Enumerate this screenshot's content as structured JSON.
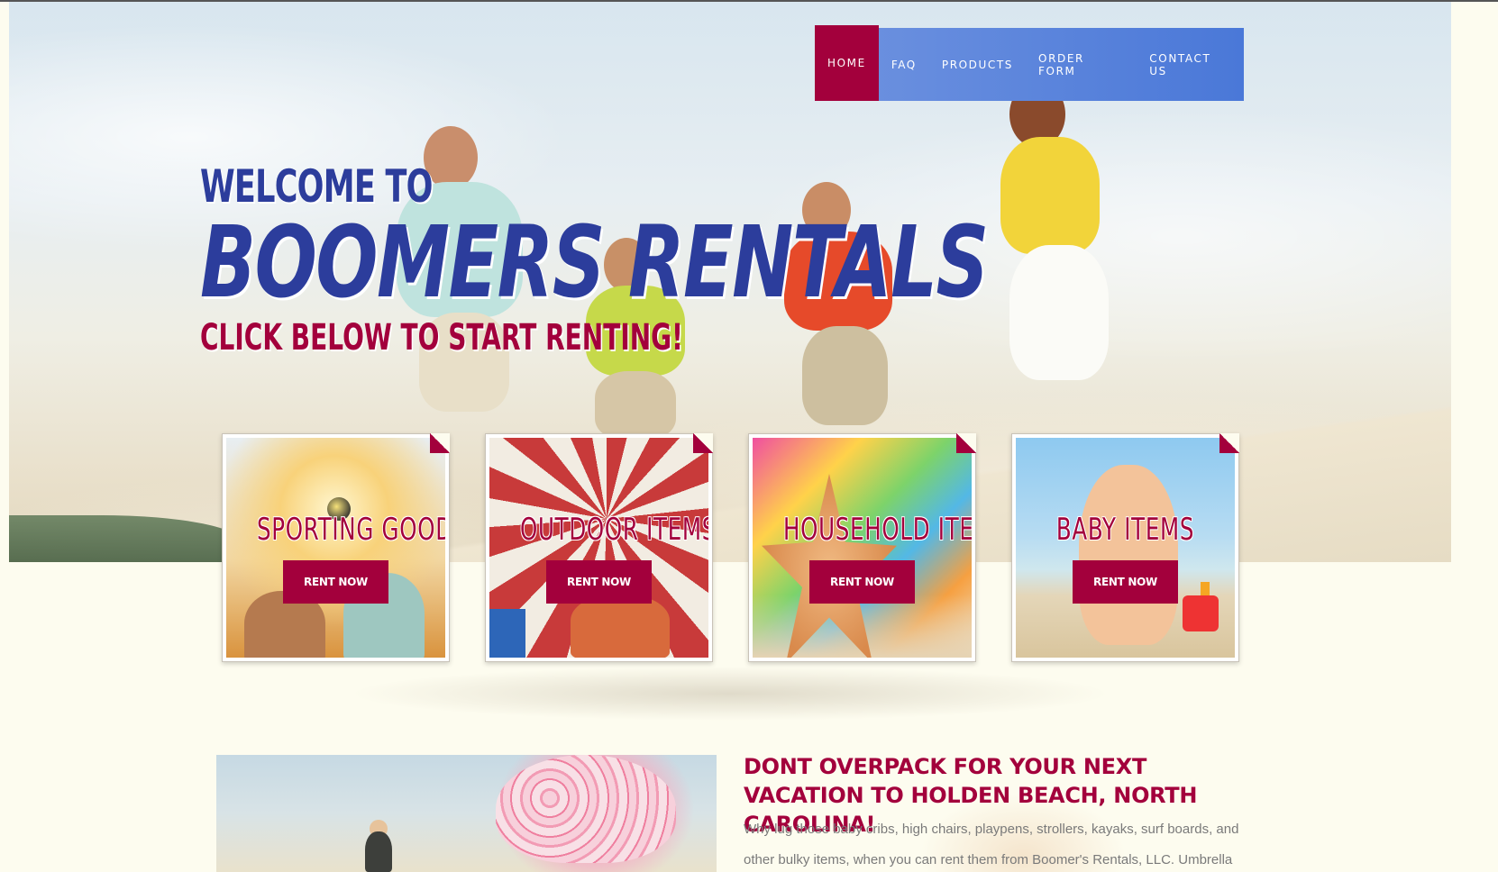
{
  "nav": {
    "items": [
      {
        "label": "HOME",
        "active": true
      },
      {
        "label": "FAQ",
        "active": false
      },
      {
        "label": "PRODUCTS",
        "active": false
      },
      {
        "label": "ORDER FORM",
        "active": false
      },
      {
        "label": "CONTACT US",
        "active": false
      }
    ]
  },
  "hero": {
    "welcome": "WELCOME TO",
    "brand": "BOOMERS RENTALS",
    "tagline": "CLICK BELOW TO START RENTING!"
  },
  "cards": [
    {
      "title": "SPORTING GOODS",
      "button": "RENT NOW"
    },
    {
      "title": "OUTDOOR ITEMS",
      "button": "RENT NOW"
    },
    {
      "title": "HOUSEHOLD ITEMS",
      "button": "RENT NOW"
    },
    {
      "title": "BABY ITEMS",
      "button": "RENT NOW"
    }
  ],
  "content": {
    "title": "DONT OVERPACK FOR YOUR NEXT VACATION TO HOLDEN BEACH, NORTH CAROLINA!",
    "body": "Why lug those baby cribs, high chairs, playpens, strollers, kayaks, surf boards, and other bulky items, when you can rent them from Boomer's Rentals, LLC. Umbrella"
  },
  "colors": {
    "accent": "#a3003c",
    "nav_blue": "#4a78d8",
    "brand_blue": "#2c3d9c",
    "page_bg": "#fdfcef"
  }
}
